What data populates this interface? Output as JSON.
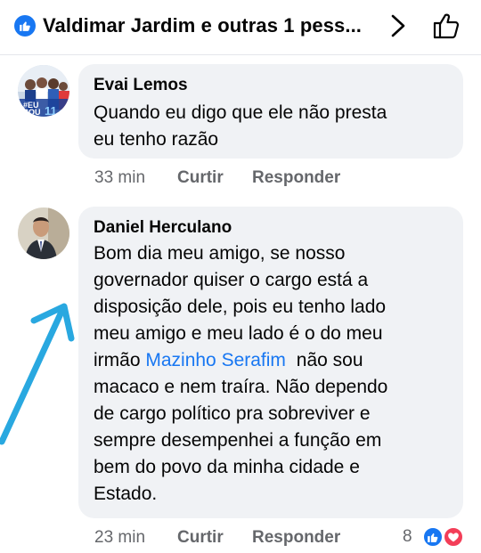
{
  "header": {
    "title": "Valdimar Jardim e outras 1 pess...",
    "like_icon": "thumbs-up-badge-icon",
    "chevron_icon": "chevron-right-icon",
    "thumb_icon": "thumbs-up-outline-icon"
  },
  "comments": [
    {
      "author": "Evai Lemos",
      "lines": [
        "Quando eu digo que ele não presta",
        "eu tenho razão"
      ],
      "time": "33 min",
      "like_label": "Curtir",
      "reply_label": "Responder",
      "avatar_badge": "#EU SOU"
    },
    {
      "author": "Daniel Herculano",
      "lines": [
        "Bom dia meu amigo, se nosso",
        "governador quiser o cargo está a",
        "disposição dele, pois eu tenho lado",
        "meu amigo e meu lado é o do meu",
        "irmão",
        "não sou",
        "macaco e nem traíra. Não dependo",
        "de cargo político pra sobreviver e",
        "sempre desempenhei a função em",
        "bem do povo da minha cidade e",
        "Estado."
      ],
      "mention": "Mazinho Serafim",
      "time": "23 min",
      "like_label": "Curtir",
      "reply_label": "Responder",
      "reaction_count": "8",
      "reaction_icons": [
        "like-reaction-icon",
        "love-reaction-icon"
      ]
    }
  ],
  "colors": {
    "accent": "#1877f2",
    "bubble": "#f0f2f5",
    "secondary_text": "#65676b",
    "love": "#f33e58",
    "annotation_arrow": "#29a8e0"
  }
}
